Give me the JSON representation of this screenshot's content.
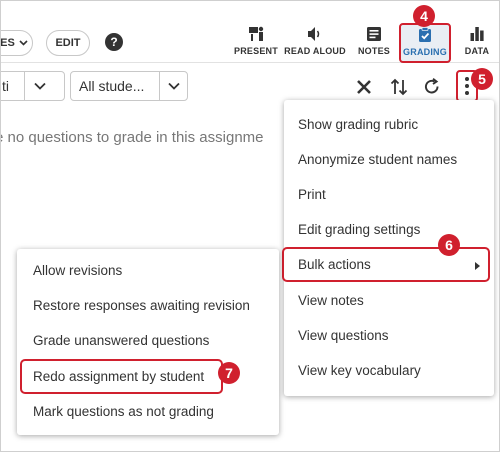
{
  "toolbar": {
    "modes_label": "ES",
    "edit_label": "EDIT",
    "help_icon": "help-circle-icon",
    "tools": [
      {
        "label": "PRESENT",
        "icon": "present-icon"
      },
      {
        "label": "READ ALOUD",
        "icon": "speaker-icon"
      },
      {
        "label": "NOTES",
        "icon": "notes-icon"
      },
      {
        "label": "GRADING",
        "icon": "grading-icon"
      },
      {
        "label": "DATA",
        "icon": "bar-chart-icon"
      }
    ]
  },
  "filters": {
    "first_value": "ti",
    "second_value": "All stude..."
  },
  "actions": {
    "close_icon": "close-icon",
    "sort_icon": "sort-arrows-icon",
    "refresh_icon": "refresh-icon",
    "more_icon": "kebab-menu-icon"
  },
  "main": {
    "empty_message": "e no questions to grade in this assignme"
  },
  "menu": {
    "items": [
      {
        "label": "Show grading rubric"
      },
      {
        "label": "Anonymize student names"
      },
      {
        "label": "Print"
      },
      {
        "label": "Edit grading settings"
      },
      {
        "label": "Bulk actions"
      },
      {
        "label": "View notes"
      },
      {
        "label": "View questions"
      },
      {
        "label": "View key vocabulary"
      }
    ]
  },
  "submenu": {
    "items": [
      {
        "label": "Allow revisions"
      },
      {
        "label": "Restore responses awaiting revision"
      },
      {
        "label": "Grade unanswered questions"
      },
      {
        "label": "Redo assignment by student"
      },
      {
        "label": "Mark questions as not grading"
      }
    ]
  },
  "callouts": {
    "grading": "4",
    "more": "5",
    "bulk": "6",
    "redo": "7"
  },
  "colors": {
    "callout": "#d0202e",
    "grading_label": "#2a6fb0",
    "grading_bg": "#e9eef4"
  }
}
